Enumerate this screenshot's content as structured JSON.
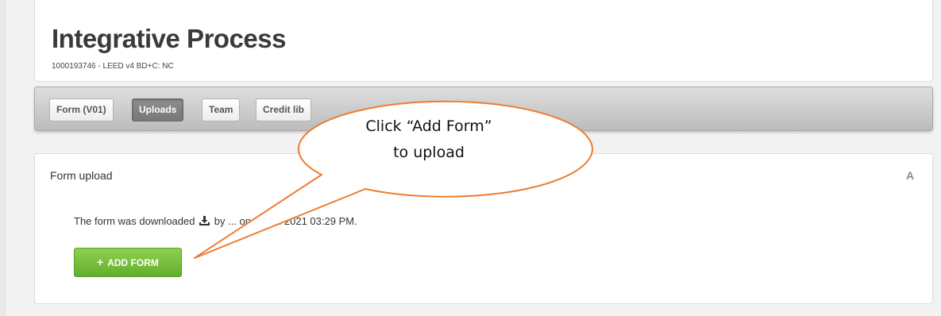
{
  "header": {
    "title": "Integrative Process",
    "subtitle": "1000193746 - LEED v4 BD+C: NC"
  },
  "tabs": [
    {
      "label": "Form (V01)",
      "active": false
    },
    {
      "label": "Uploads",
      "active": true
    },
    {
      "label": "Team",
      "active": false
    },
    {
      "label": "Credit lib",
      "active": false
    }
  ],
  "upload_panel": {
    "title": "Form upload",
    "corner_icon": "A",
    "download_text_before": "The form was downloaded",
    "download_icon": "download-icon",
    "download_text_after": "by ... on 21 Jul 2021 03:29 PM.",
    "add_button": {
      "icon": "+",
      "label": "ADD FORM"
    }
  },
  "callout": {
    "line1": "Click “Add Form”",
    "line2": "to upload",
    "stroke_color": "#ed7d31"
  },
  "colors": {
    "button_green": "#6cb435",
    "active_tab": "#808080",
    "tab_bar": "#c8c8c8"
  }
}
